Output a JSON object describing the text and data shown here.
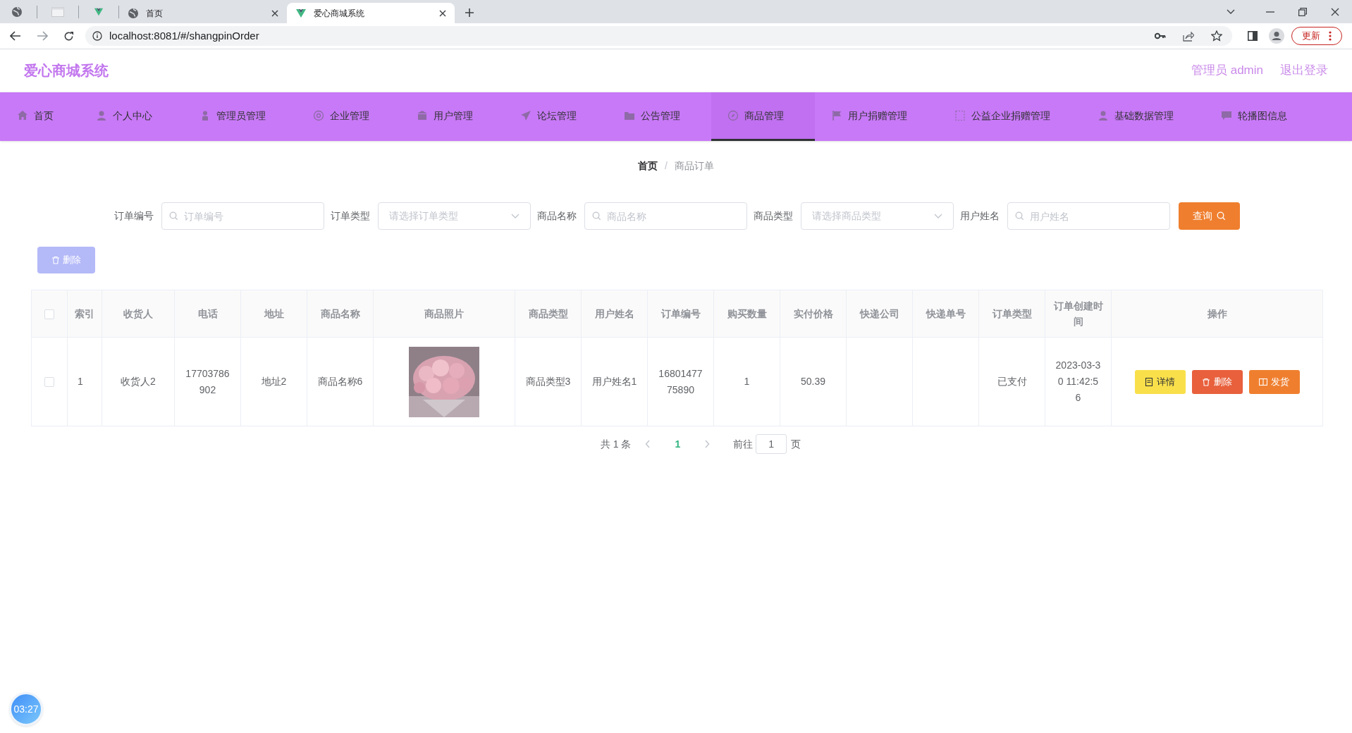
{
  "browser": {
    "tabs": [
      {
        "title": "首页",
        "selected": false
      },
      {
        "title": "爱心商城系统",
        "selected": true
      }
    ],
    "address": "localhost:8081/#/shangpinOrder",
    "update_button": "更新"
  },
  "header": {
    "title": "爱心商城系统",
    "user": "管理员 admin",
    "logout": "退出登录"
  },
  "nav": [
    {
      "label": "首页",
      "selected": false
    },
    {
      "label": "个人中心",
      "selected": false
    },
    {
      "label": "管理员管理",
      "selected": false
    },
    {
      "label": "企业管理",
      "selected": false
    },
    {
      "label": "用户管理",
      "selected": false
    },
    {
      "label": "论坛管理",
      "selected": false
    },
    {
      "label": "公告管理",
      "selected": false
    },
    {
      "label": "商品管理",
      "selected": true
    },
    {
      "label": "用户捐赠管理",
      "selected": false
    },
    {
      "label": "公益企业捐赠管理",
      "selected": false
    },
    {
      "label": "基础数据管理",
      "selected": false
    },
    {
      "label": "轮播图信息",
      "selected": false
    }
  ],
  "breadcrumb": {
    "items": [
      "首页",
      "商品订单"
    ],
    "separator": "/"
  },
  "search": {
    "fields": [
      {
        "label": "订单编号",
        "kind": "input",
        "placeholder": "订单编号"
      },
      {
        "label": "订单类型",
        "kind": "select",
        "placeholder": "请选择订单类型"
      },
      {
        "label": "商品名称",
        "kind": "input",
        "placeholder": "商品名称"
      },
      {
        "label": "商品类型",
        "kind": "select",
        "placeholder": "请选择商品类型"
      },
      {
        "label": "用户姓名",
        "kind": "input",
        "placeholder": "用户姓名"
      }
    ],
    "button": "查询"
  },
  "delete_button": "删除",
  "table": {
    "header_checked": false,
    "columns": [
      "索引",
      "收货人",
      "电话",
      "地址",
      "商品名称",
      "商品照片",
      "商品类型",
      "用户姓名",
      "订单编号",
      "购买数量",
      "实付价格",
      "快递公司",
      "快递单号",
      "订单类型",
      "订单创建时间",
      "操作"
    ],
    "rows": [
      {
        "checked": false,
        "cells": [
          {
            "kind": "text",
            "text": "1"
          },
          {
            "kind": "text",
            "text": "收货人2"
          },
          {
            "kind": "text",
            "text": "17703786902"
          },
          {
            "kind": "text",
            "text": "地址2"
          },
          {
            "kind": "text",
            "text": "商品名称6"
          },
          {
            "kind": "picture"
          },
          {
            "kind": "text",
            "text": "商品类型3"
          },
          {
            "kind": "text",
            "text": "用户姓名1"
          },
          {
            "kind": "text",
            "text": "1680147775890"
          },
          {
            "kind": "text",
            "text": "1"
          },
          {
            "kind": "text",
            "text": "50.39"
          },
          {
            "kind": "empty"
          },
          {
            "kind": "empty"
          },
          {
            "kind": "text",
            "text": "已支付"
          },
          {
            "kind": "text",
            "text": "2023-03-30 11:42:56"
          },
          {
            "kind": "actions",
            "buttons": [
              {
                "label": "详情",
                "kind": "detail"
              },
              {
                "label": "删除",
                "kind": "delete"
              },
              {
                "label": "发货",
                "kind": "ship"
              }
            ]
          }
        ]
      }
    ]
  },
  "pagination": {
    "total": "共 1 条",
    "pages": [
      {
        "label": "1",
        "selected": true
      }
    ],
    "goto_label": "前往",
    "goto_value": "1",
    "page_suffix": "页"
  },
  "timer": "03:27"
}
